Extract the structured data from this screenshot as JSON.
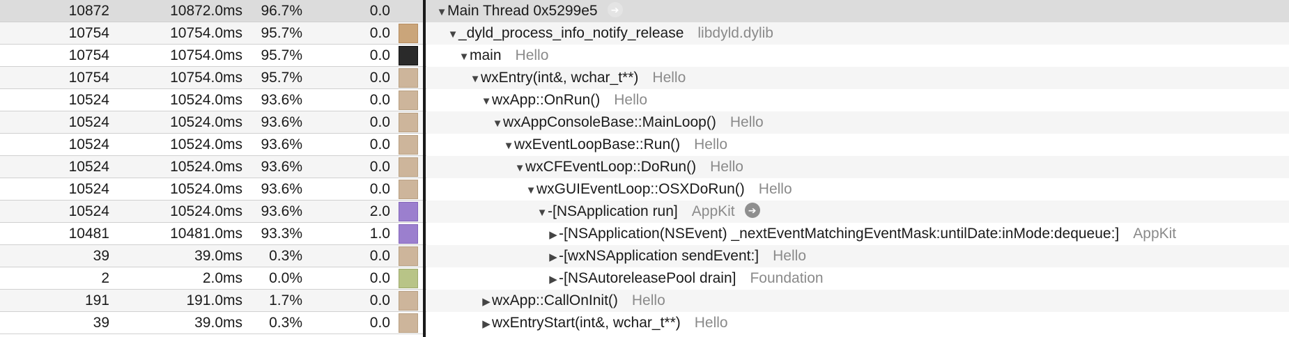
{
  "rows": [
    {
      "count": "10872",
      "time": "10872.0ms",
      "percent": "96.7%",
      "self": "0.0",
      "icon": "thread-icon",
      "depth": 0,
      "expanded": true,
      "symbol": "Main Thread  0x5299e5",
      "library": "",
      "arrow": "light",
      "selected": true
    },
    {
      "count": "10754",
      "time": "10754.0ms",
      "percent": "95.7%",
      "self": "0.0",
      "icon": "gear-icon",
      "depth": 1,
      "expanded": true,
      "symbol": "_dyld_process_info_notify_release",
      "library": "libdyld.dylib"
    },
    {
      "count": "10754",
      "time": "10754.0ms",
      "percent": "95.7%",
      "self": "0.0",
      "icon": "user-icon",
      "depth": 2,
      "expanded": true,
      "symbol": "main",
      "library": "Hello"
    },
    {
      "count": "10754",
      "time": "10754.0ms",
      "percent": "95.7%",
      "self": "0.0",
      "icon": "library-icon",
      "depth": 3,
      "expanded": true,
      "symbol": "wxEntry(int&, wchar_t**)",
      "library": "Hello"
    },
    {
      "count": "10524",
      "time": "10524.0ms",
      "percent": "93.6%",
      "self": "0.0",
      "icon": "library-icon",
      "depth": 4,
      "expanded": true,
      "symbol": "wxApp::OnRun()",
      "library": "Hello"
    },
    {
      "count": "10524",
      "time": "10524.0ms",
      "percent": "93.6%",
      "self": "0.0",
      "icon": "library-icon",
      "depth": 5,
      "expanded": true,
      "symbol": "wxAppConsoleBase::MainLoop()",
      "library": "Hello"
    },
    {
      "count": "10524",
      "time": "10524.0ms",
      "percent": "93.6%",
      "self": "0.0",
      "icon": "library-icon",
      "depth": 6,
      "expanded": true,
      "symbol": "wxEventLoopBase::Run()",
      "library": "Hello"
    },
    {
      "count": "10524",
      "time": "10524.0ms",
      "percent": "93.6%",
      "self": "0.0",
      "icon": "library-icon",
      "depth": 7,
      "expanded": true,
      "symbol": "wxCFEventLoop::DoRun()",
      "library": "Hello"
    },
    {
      "count": "10524",
      "time": "10524.0ms",
      "percent": "93.6%",
      "self": "0.0",
      "icon": "library-icon",
      "depth": 8,
      "expanded": true,
      "symbol": "wxGUIEventLoop::OSXDoRun()",
      "library": "Hello"
    },
    {
      "count": "10524",
      "time": "10524.0ms",
      "percent": "93.6%",
      "self": "2.0",
      "icon": "appkit-icon",
      "depth": 9,
      "expanded": true,
      "symbol": "-[NSApplication run]",
      "library": "AppKit",
      "arrow": "dark"
    },
    {
      "count": "10481",
      "time": "10481.0ms",
      "percent": "93.3%",
      "self": "1.0",
      "icon": "appkit-icon",
      "depth": 10,
      "expanded": false,
      "symbol": "-[NSApplication(NSEvent) _nextEventMatchingEventMask:untilDate:inMode:dequeue:]",
      "library": "AppKit"
    },
    {
      "count": "39",
      "time": "39.0ms",
      "percent": "0.3%",
      "self": "0.0",
      "icon": "library-icon",
      "depth": 10,
      "expanded": false,
      "symbol": "-[wxNSApplication sendEvent:]",
      "library": "Hello"
    },
    {
      "count": "2",
      "time": "2.0ms",
      "percent": "0.0%",
      "self": "0.0",
      "icon": "foundation-icon",
      "depth": 10,
      "expanded": false,
      "symbol": "-[NSAutoreleasePool drain]",
      "library": "Foundation"
    },
    {
      "count": "191",
      "time": "191.0ms",
      "percent": "1.7%",
      "self": "0.0",
      "icon": "library-icon",
      "depth": 4,
      "expanded": false,
      "symbol": "wxApp::CallOnInit()",
      "library": "Hello"
    },
    {
      "count": "39",
      "time": "39.0ms",
      "percent": "0.3%",
      "self": "0.0",
      "icon": "library-icon",
      "depth": 4,
      "expanded": false,
      "symbol": "wxEntryStart(int&, wchar_t**)",
      "library": "Hello"
    }
  ],
  "glyphs": {
    "expanded": "▼",
    "collapsed": "▶",
    "arrow": "➔"
  },
  "colors": {
    "library_text": "#8a8a8a",
    "selected_row": "#dcdcdc",
    "appkit": "#9b7fce",
    "library": "#cdb59b"
  }
}
